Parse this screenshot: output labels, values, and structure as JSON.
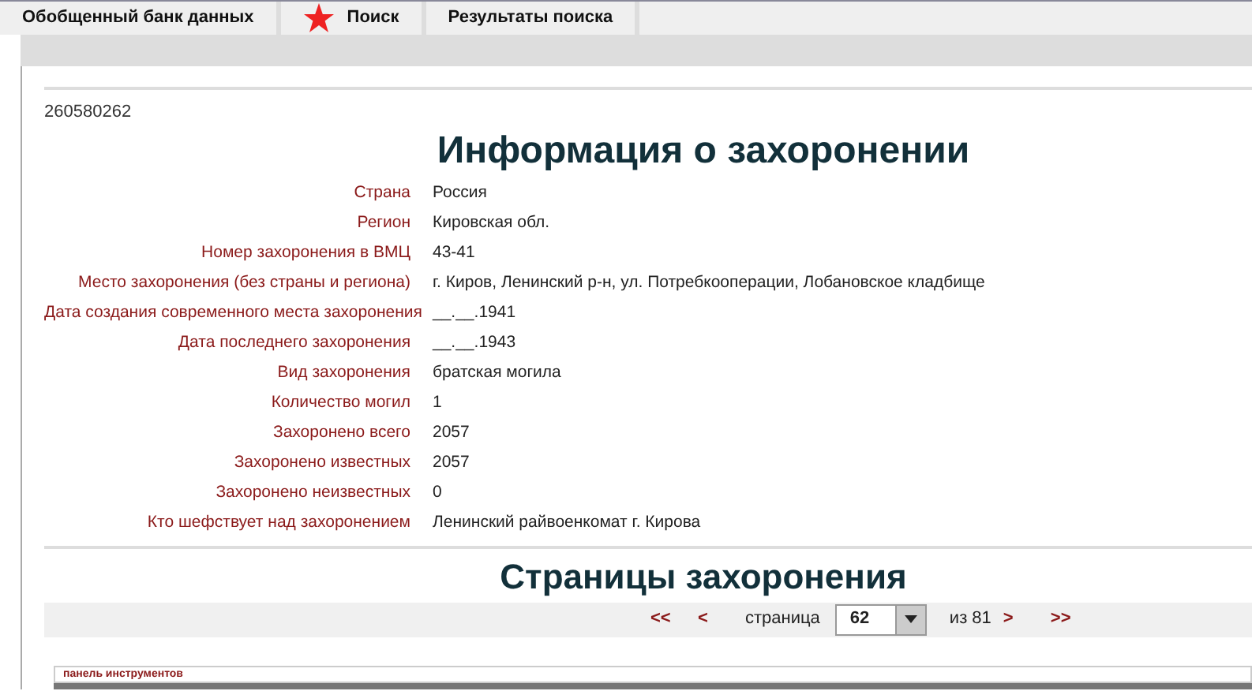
{
  "tabs": [
    {
      "label": "Обобщенный банк данных",
      "selected": false,
      "icon": false
    },
    {
      "label": "Поиск",
      "selected": false,
      "icon": true
    },
    {
      "label": "Результаты поиска",
      "selected": false,
      "icon": false
    }
  ],
  "record_id": "260580262",
  "title": "Информация о захоронении",
  "fields": [
    {
      "label": "Страна",
      "value": "Россия"
    },
    {
      "label": "Регион",
      "value": "Кировская обл."
    },
    {
      "label": "Номер захоронения в ВМЦ",
      "value": "43-41"
    },
    {
      "label": "Место захоронения (без страны и региона)",
      "value": "г. Киров, Ленинский р-н, ул. Потребкооперации, Лобановское кладбище"
    },
    {
      "label": "Дата создания современного места захоронения",
      "value": "__.__.1941"
    },
    {
      "label": "Дата последнего захоронения",
      "value": "__.__.1943"
    },
    {
      "label": "Вид захоронения",
      "value": "братская могила"
    },
    {
      "label": "Количество могил",
      "value": "1"
    },
    {
      "label": "Захоронено всего",
      "value": "2057"
    },
    {
      "label": "Захоронено известных",
      "value": "2057"
    },
    {
      "label": "Захоронено неизвестных",
      "value": "0"
    },
    {
      "label": "Кто шефствует над захоронением",
      "value": "Ленинский райвоенкомат г. Кирова"
    }
  ],
  "pages_title": "Страницы захоронения",
  "pager": {
    "first": "<<",
    "prev": "<",
    "page_label": "страница",
    "page": "62",
    "total": "из 81",
    "next": ">",
    "last": ">>"
  },
  "toolbar": {
    "label": "панель инструментов"
  }
}
